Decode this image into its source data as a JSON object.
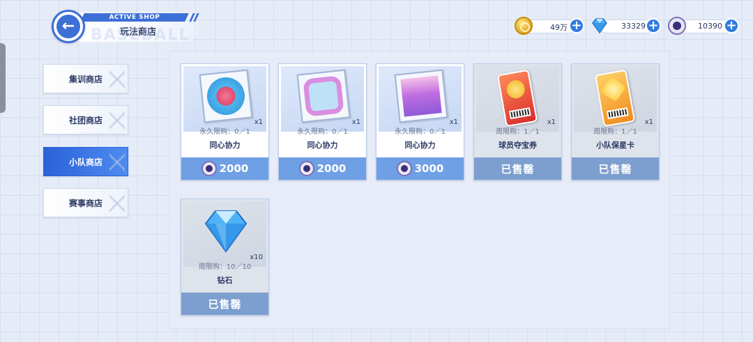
{
  "header": {
    "tag": "ACTIVE SHOP",
    "title": "玩法商店",
    "watermark": "BASEBALL"
  },
  "currencies": [
    {
      "icon": "gold-coin-icon",
      "value": "49万"
    },
    {
      "icon": "diamond-icon",
      "value": "33329"
    },
    {
      "icon": "team-token-icon",
      "value": "10390"
    }
  ],
  "tabs": [
    {
      "label": "集训商店",
      "active": false
    },
    {
      "label": "社团商店",
      "active": false
    },
    {
      "label": "小队商店",
      "active": true
    },
    {
      "label": "赛事商店",
      "active": false
    }
  ],
  "items": [
    {
      "name": "同心协力",
      "limit": "永久限购：0／1",
      "qty": "x1",
      "price": "2000",
      "sold": false,
      "art": "red-envelope-frame"
    },
    {
      "name": "同心协力",
      "limit": "永久限购：0／1",
      "qty": "x1",
      "price": "2000",
      "sold": false,
      "art": "floral-frame"
    },
    {
      "name": "同心协力",
      "limit": "永久限购：0／1",
      "qty": "x1",
      "price": "3000",
      "sold": false,
      "art": "stage-frame"
    },
    {
      "name": "球员夺宝券",
      "limit": "周限购：1／1",
      "qty": "x1",
      "price": "已售罄",
      "sold": true,
      "art": "red-ticket"
    },
    {
      "name": "小队保星卡",
      "limit": "周限购：1／1",
      "qty": "x1",
      "price": "已售罄",
      "sold": true,
      "art": "orange-star-ticket"
    },
    {
      "name": "钻石",
      "limit": "周限购：10／10",
      "qty": "x10",
      "price": "已售罄",
      "sold": true,
      "art": "diamond"
    }
  ],
  "colors": {
    "accent": "#3d6fd6",
    "price_bar": "#6f9fe4",
    "sold_bar": "#7d9fcf"
  }
}
